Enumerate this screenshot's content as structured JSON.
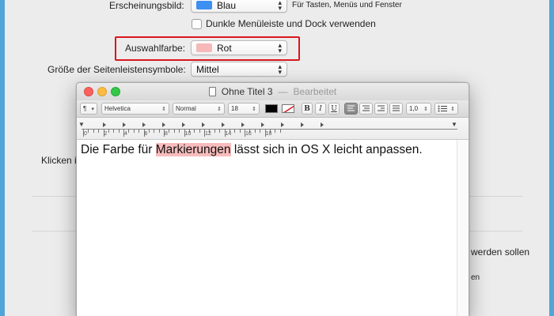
{
  "prefs": {
    "appearance_label": "Erscheinungsbild:",
    "appearance_value": "Blau",
    "appearance_hint": "Für Tasten, Menüs und Fenster",
    "dark_menu_label": "Dunkle Menüleiste und Dock verwenden",
    "highlight_label": "Auswahlfarbe:",
    "highlight_value": "Rot",
    "sidebar_size_label": "Größe der Seitenleistensymbole:",
    "sidebar_size_value": "Mittel",
    "partial_click": "Klicken i",
    "partial_right_1": "werden sollen",
    "partial_right_2": "en",
    "colors": {
      "appearance_swatch": "#3d8ff2",
      "highlight_swatch": "#f6b8b8",
      "annotation_box": "#d9171d"
    }
  },
  "window": {
    "title": "Ohne Titel 3",
    "separator": "—",
    "status": "Bearbeitet"
  },
  "toolbar": {
    "paragraph_style": "¶",
    "font_family": "Helvetica",
    "font_style": "Normal",
    "font_size": "18",
    "bold": "B",
    "italic": "I",
    "underline": "U",
    "line_spacing": "1,0",
    "list_icon": "list-icon"
  },
  "ruler": {
    "numbers": [
      "0",
      "2",
      "4",
      "6",
      "8",
      "10",
      "12",
      "14",
      "16",
      "18"
    ]
  },
  "document": {
    "before": "Die Farbe für ",
    "highlighted": "Markierungen",
    "after": " lässt sich in OS X leicht anpassen."
  }
}
